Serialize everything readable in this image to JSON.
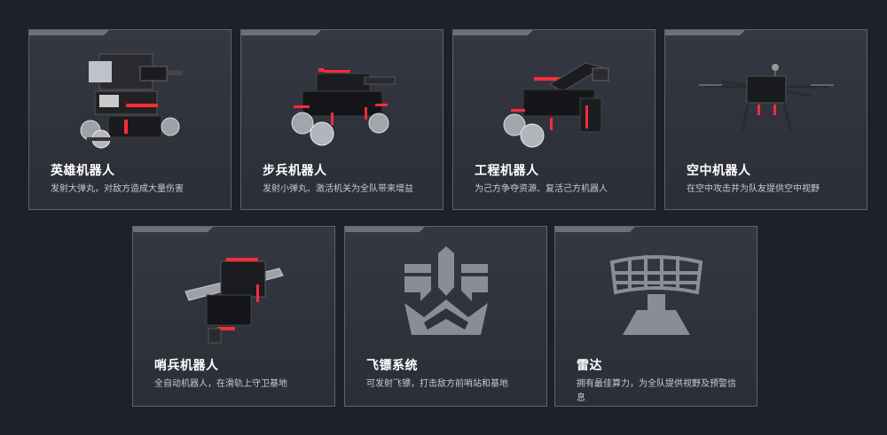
{
  "cards": [
    {
      "title": "英雄机器人",
      "desc": "发射大弹丸，对敌方造成大量伤害",
      "icon": "hero-robot-icon"
    },
    {
      "title": "步兵机器人",
      "desc": "发射小弹丸、激活机关为全队带来增益",
      "icon": "infantry-robot-icon"
    },
    {
      "title": "工程机器人",
      "desc": "为己方争夺资源、复活己方机器人",
      "icon": "engineer-robot-icon"
    },
    {
      "title": "空中机器人",
      "desc": "在空中攻击并为队友提供空中视野",
      "icon": "aerial-drone-icon"
    },
    {
      "title": "哨兵机器人",
      "desc": "全自动机器人，在滑轨上守卫基地",
      "icon": "sentry-robot-icon"
    },
    {
      "title": "飞镖系统",
      "desc": "可发射飞镖，打击敌方前哨站和基地",
      "icon": "dart-system-icon"
    },
    {
      "title": "雷达",
      "desc": "拥有最佳算力，为全队提供视野及预警信息",
      "icon": "radar-icon"
    }
  ],
  "colors": {
    "background": "#1f2128",
    "card": "#32353e",
    "border": "#5f6270",
    "accent_red": "#ff2a3a",
    "icon_gray": "#8a8d97"
  }
}
